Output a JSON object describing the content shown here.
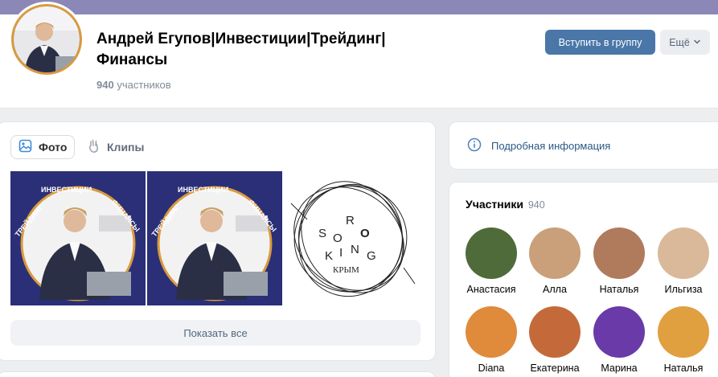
{
  "group": {
    "title": "Андрей Егупов|Инвестиции|Трейдинг|Финансы",
    "members_number": "940",
    "members_word": "участников"
  },
  "header": {
    "join_label": "Вступить в группу",
    "more_label": "Ещё"
  },
  "photos": {
    "tabs": [
      {
        "label": "Фото",
        "active": true
      },
      {
        "label": "Клипы",
        "active": false
      }
    ],
    "banner_top": "ИНВЕСТИЦИИ",
    "banner_left": "ТРЕЙДИНГ",
    "banner_right": "ФИНАНСЫ",
    "logo_letters": [
      "S",
      "O",
      "R",
      "O",
      "K",
      "I",
      "N",
      "G"
    ],
    "logo_city": "КРЫМ",
    "show_all_label": "Показать все"
  },
  "info": {
    "label": "Подробная информация"
  },
  "members": {
    "title": "Участники",
    "count": "940",
    "list": [
      {
        "name": "Анастасия",
        "color": "#4f6b3a"
      },
      {
        "name": "Алла",
        "color": "#c9a07a"
      },
      {
        "name": "Наталья",
        "color": "#b07a5c"
      },
      {
        "name": "Ильгиза",
        "color": "#d9b99a"
      },
      {
        "name": "Diana",
        "color": "#e08a3c"
      },
      {
        "name": "Екатерина",
        "color": "#c46a3a"
      },
      {
        "name": "Марина",
        "color": "#6a3aa8"
      },
      {
        "name": "Наталья",
        "color": "#e0a040"
      }
    ]
  },
  "colors": {
    "accent": "#4a76a8",
    "cover": "#8b88b8",
    "link": "#2a5885"
  }
}
